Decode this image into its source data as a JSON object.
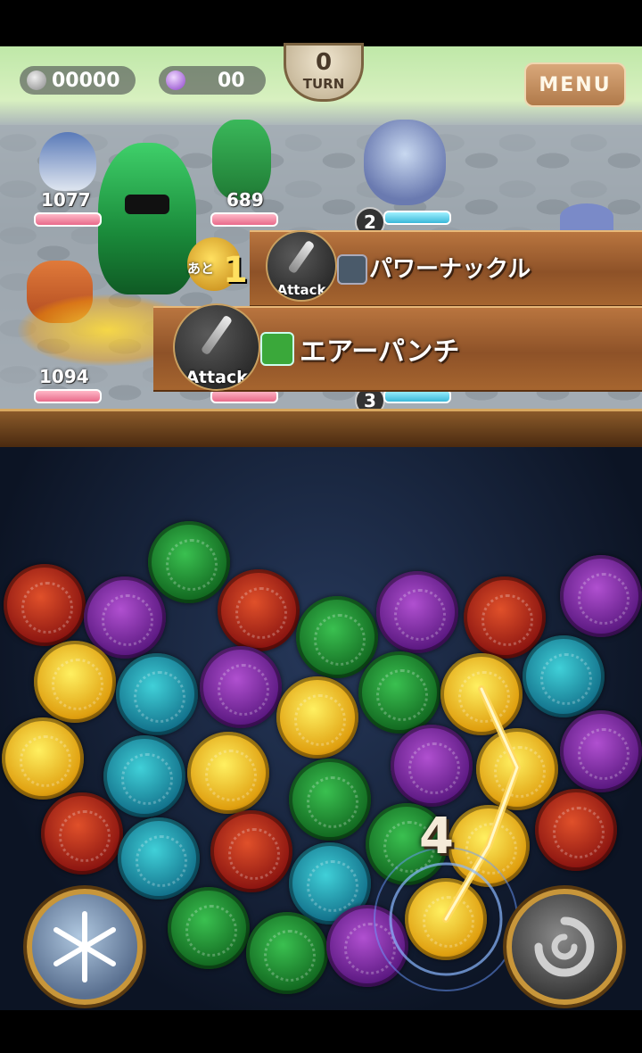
{
  "hud": {
    "coins": "00000",
    "gems": "00",
    "turn_number": "0",
    "turn_label": "TURN",
    "menu_label": "MENU"
  },
  "party": [
    {
      "hp": "1077"
    },
    {
      "hp": "689"
    },
    {
      "hp": "1094"
    }
  ],
  "enemy_badges": [
    "2",
    "3"
  ],
  "countdown": {
    "prefix": "あと",
    "value": "1"
  },
  "attack_banners": [
    {
      "icon_label": "Attack",
      "skill_name": "パワーナックル",
      "element": "neutral",
      "element_color": "#4a5a6a"
    },
    {
      "icon_label": "Attack",
      "skill_name": "エアーパンチ",
      "element": "wind",
      "element_color": "#3aa83a"
    }
  ],
  "combo_count": "4",
  "board": {
    "orbs": [
      [
        "red",
        "purple",
        "green",
        "red",
        "green",
        "purple",
        "red",
        "purple"
      ],
      [
        "yellow",
        "cyan",
        "purple",
        "yellow",
        "green",
        "yellow",
        "cyan"
      ],
      [
        "yellow",
        "cyan",
        "yellow",
        "green",
        "purple",
        "yellow",
        "purple"
      ],
      [
        "red",
        "cyan",
        "red",
        "cyan",
        "green",
        "yellow",
        "red"
      ],
      [
        "green",
        "green",
        "purple",
        "yellow"
      ]
    ]
  },
  "buttons": {
    "left_skill": "snowflake-icon",
    "right_skill": "swirl-icon"
  }
}
